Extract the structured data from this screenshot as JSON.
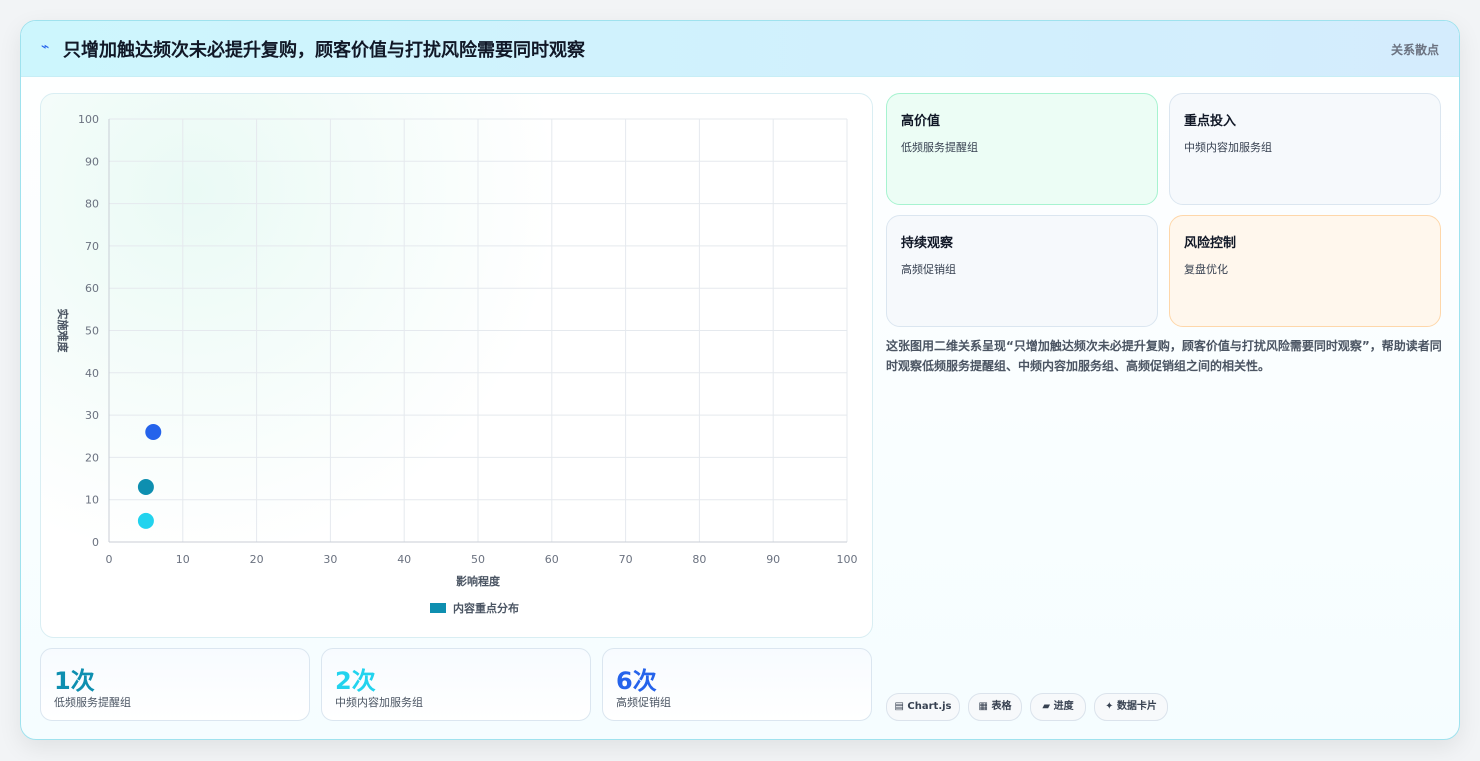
{
  "header": {
    "icon": "⌁",
    "title": "只增加触达频次未必提升复购，顾客价值与打扰风险需要同时观察",
    "tag": "关系散点"
  },
  "chart_data": {
    "type": "scatter",
    "title": "",
    "xlabel": "影响程度",
    "ylabel": "实施难度",
    "xlim": [
      0,
      100
    ],
    "ylim": [
      0,
      100
    ],
    "xticks": [
      "0",
      "10",
      "20",
      "30",
      "40",
      "50",
      "60",
      "70",
      "80",
      "90",
      "100"
    ],
    "yticks": [
      "0",
      "10",
      "20",
      "30",
      "40",
      "50",
      "60",
      "70",
      "80",
      "90",
      "100"
    ],
    "grid": true,
    "legend_position": "bottom",
    "series": [
      {
        "name": "内容重点分布",
        "legend_color": "#0e8fb0",
        "points": [
          {
            "x": 5,
            "y": 13,
            "color": "#0e8fb0"
          },
          {
            "x": 5,
            "y": 5,
            "color": "#22d3ee"
          },
          {
            "x": 6,
            "y": 26,
            "color": "#2563eb"
          }
        ]
      }
    ]
  },
  "stats": [
    {
      "value": "1次",
      "label": "低频服务提醒组",
      "color": "#0e8fb0"
    },
    {
      "value": "2次",
      "label": "中频内容加服务组",
      "color": "#22d3ee"
    },
    {
      "value": "6次",
      "label": "高频促销组",
      "color": "#2563eb"
    }
  ],
  "quadrants": [
    {
      "title": "高价值",
      "sub": "低频服务提醒组",
      "bg": "#ecfdf5",
      "border": "#a7f3d0"
    },
    {
      "title": "重点投入",
      "sub": "中频内容加服务组",
      "bg": "#f6f9fc",
      "border": "#dbe6f0"
    },
    {
      "title": "持续观察",
      "sub": "高频促销组",
      "bg": "#f6f9fc",
      "border": "#dbe6f0"
    },
    {
      "title": "风险控制",
      "sub": "复盘优化",
      "bg": "#fff7ed",
      "border": "#fed7aa"
    }
  ],
  "description": "这张图用二维关系呈现“只增加触达频次未必提升复购，顾客价值与打扰风险需要同时观察”，帮助读者同时观察低频服务提醒组、中频内容加服务组、高频促销组之间的相关性。",
  "pills": [
    {
      "icon": "▤",
      "label": "Chart.js"
    },
    {
      "icon": "▦",
      "label": "表格"
    },
    {
      "icon": "▰",
      "label": "进度"
    },
    {
      "icon": "✦",
      "label": "数据卡片"
    }
  ]
}
